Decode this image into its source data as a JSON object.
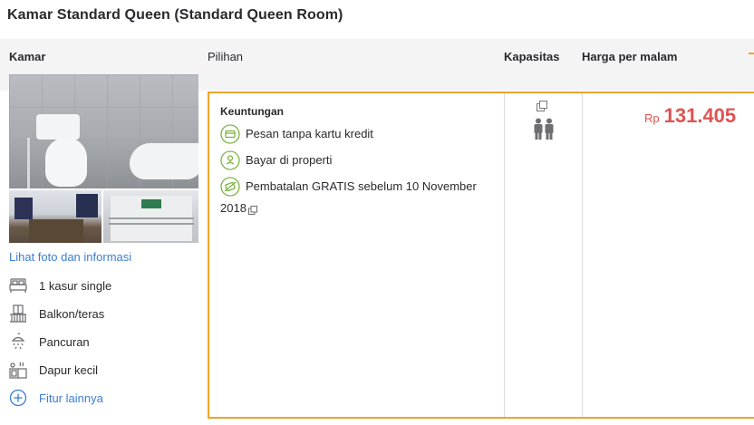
{
  "room": {
    "title": "Kamar Standard Queen (Standard Queen Room)"
  },
  "columns": {
    "kamar": "Kamar",
    "pilihan": "Pilihan",
    "kapasitas": "Kapasitas",
    "harga": "Harga per malam"
  },
  "photos": {
    "link_label": "Lihat foto dan informasi"
  },
  "facilities": [
    {
      "icon": "bed-icon",
      "label": "1 kasur single"
    },
    {
      "icon": "balcony-icon",
      "label": "Balkon/teras"
    },
    {
      "icon": "shower-icon",
      "label": "Pancuran"
    },
    {
      "icon": "kitchen-icon",
      "label": "Dapur kecil"
    },
    {
      "icon": "plus-circle-icon",
      "label": "Fitur lainnya"
    }
  ],
  "option": {
    "benefits_heading": "Keuntungan",
    "benefits": [
      {
        "icon": "credit-card-icon",
        "text": "Pesan tanpa kartu kredit"
      },
      {
        "icon": "pay-at-property-icon",
        "text": "Bayar di properti"
      },
      {
        "icon": "free-cancel-icon",
        "text": "Pembatalan GRATIS sebelum 10 November",
        "text_line2": "2018"
      }
    ],
    "capacity_icon": "two-persons-icon",
    "price": {
      "currency": "Rp",
      "amount": "131.405"
    }
  },
  "colors": {
    "accent_border": "#f0a32a",
    "price": "#e05252",
    "link": "#3b7dd6",
    "benefit_icon": "#7cb342"
  }
}
